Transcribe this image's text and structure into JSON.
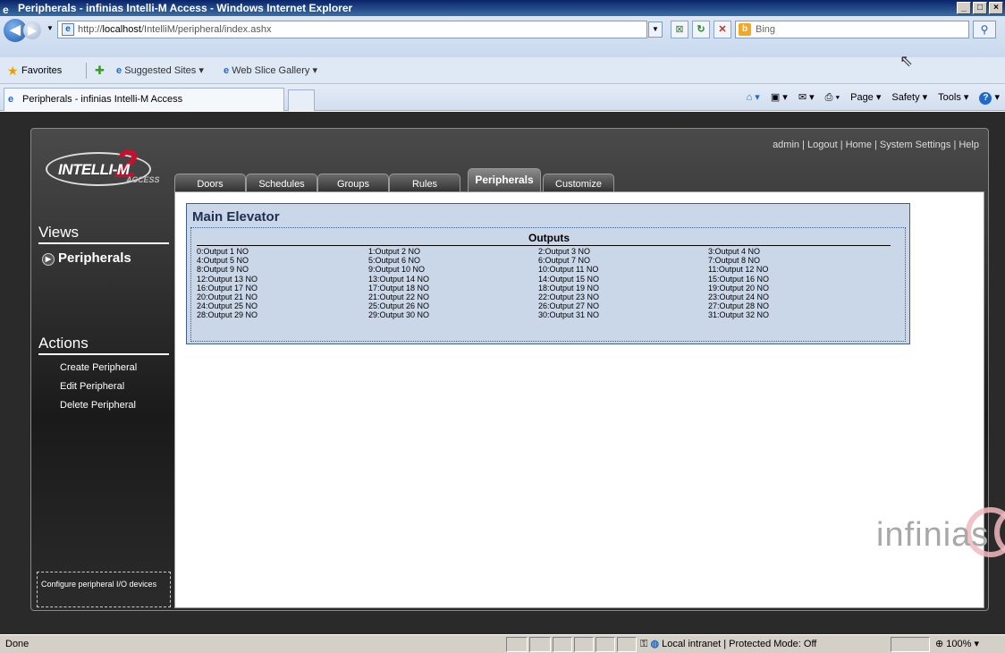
{
  "window": {
    "title": "Peripherals - infinias Intelli-M Access - Windows Internet Explorer",
    "buttons": [
      "_",
      "□",
      "×"
    ]
  },
  "address": {
    "url_prefix": "http://",
    "url_host": "localhost",
    "url_path": "/IntelliM/peripheral/index.ashx",
    "search_placeholder": "Bing"
  },
  "favorites": {
    "label": "Favorites",
    "suggested": "Suggested Sites ▾",
    "slice": "Web Slice Gallery ▾"
  },
  "tab": {
    "label": "Peripherals - infinias Intelli-M Access"
  },
  "commandbar": {
    "page": "Page ▾",
    "safety": "Safety ▾",
    "tools": "Tools ▾"
  },
  "app": {
    "logo_text": "INTELLI-M",
    "logo_two": "2",
    "logo_access": "ACCESS",
    "toplinks": "admin | Logout | Home | System Settings | Help",
    "tabs": [
      "Doors",
      "Schedules",
      "Groups",
      "Rules",
      "Peripherals",
      "Customize"
    ],
    "sidebar": {
      "views_heading": "Views",
      "views_item": "Peripherals",
      "actions_heading": "Actions",
      "actions": [
        "Create Peripheral",
        "Edit Peripheral",
        "Delete Peripheral"
      ],
      "hint": "Configure peripheral I/O devices"
    },
    "panel": {
      "title": "Main Elevator",
      "outputs_heading": "Outputs",
      "outputs": [
        "0:Output 1 NO",
        "1:Output 2 NO",
        "2:Output 3 NO",
        "3:Output 4 NO",
        "4:Output 5 NO",
        "5:Output 6 NO",
        "6:Output 7 NO",
        "7:Output 8 NO",
        "8:Output 9 NO",
        "9:Output 10 NO",
        "10:Output 11 NO",
        "11:Output 12 NO",
        "12:Output 13 NO",
        "13:Output 14 NO",
        "14:Output 15 NO",
        "15:Output 16 NO",
        "16:Output 17 NO",
        "17:Output 18 NO",
        "18:Output 19 NO",
        "19:Output 20 NO",
        "20:Output 21 NO",
        "21:Output 22 NO",
        "22:Output 23 NO",
        "23:Output 24 NO",
        "24:Output 25 NO",
        "25:Output 26 NO",
        "26:Output 27 NO",
        "27:Output 28 NO",
        "28:Output 29 NO",
        "29:Output 30 NO",
        "30:Output 31 NO",
        "31:Output 32 NO"
      ]
    },
    "brand_watermark": "infinias"
  },
  "status": {
    "text": "Done",
    "zone": "Local intranet | Protected Mode: Off",
    "zoom": "100%"
  }
}
